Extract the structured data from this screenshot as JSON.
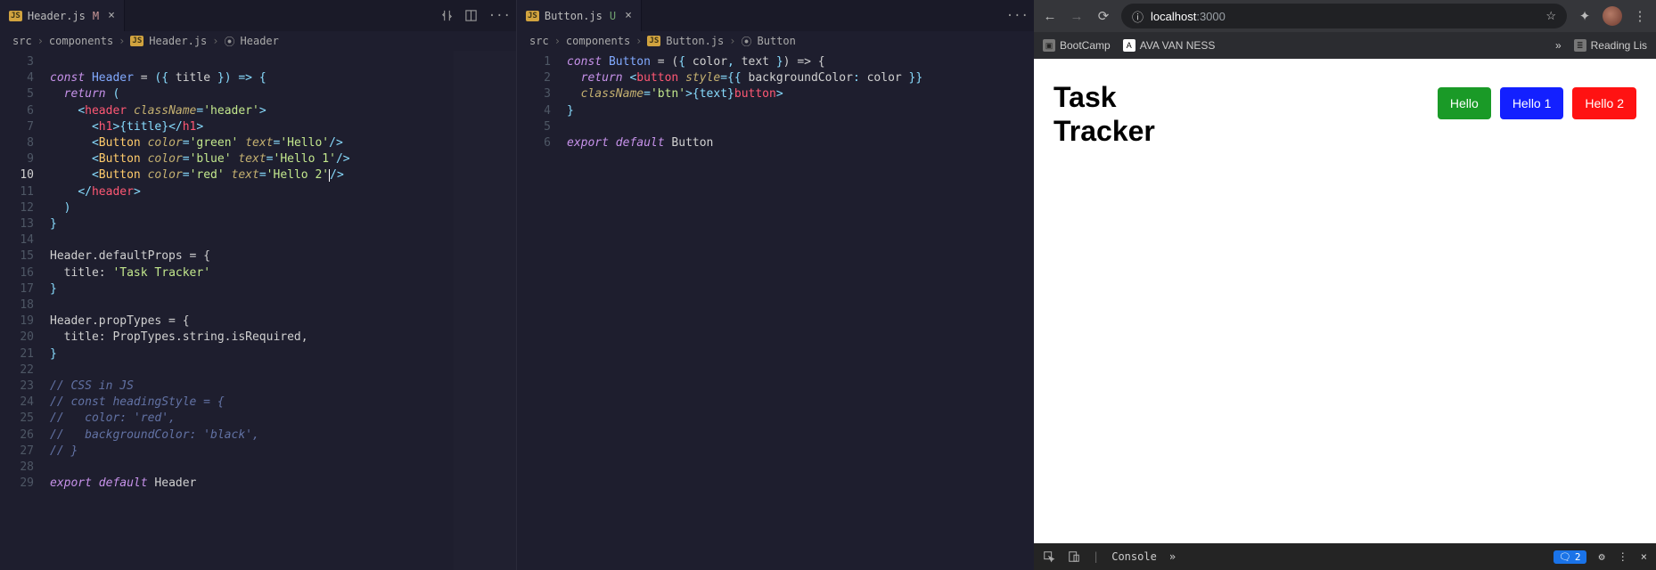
{
  "left": {
    "tab": {
      "file": "Header.js",
      "status": "M"
    },
    "breadcrumb": {
      "p1": "src",
      "p2": "components",
      "p3": "Header.js",
      "sym": "Header"
    },
    "lines_start": 3,
    "lines_end": 29,
    "tokens": {
      "const": "const",
      "header_name": "Header",
      "eq": " = ",
      "paren_open": "(",
      "brace_open": "{",
      "title_param": "title",
      "brace_close": "}",
      "paren_close": ")",
      "arrow": " => ",
      "obrace": "{",
      "return": "return",
      "jsx_open": "(",
      "tag_header": "header",
      "attr_class": "className",
      "val_header": "'header'",
      "h1": "h1",
      "title_expr": "{title}",
      "btn_tag": "Button",
      "attr_color": "color",
      "attr_text": "text",
      "c_green": "'green'",
      "t_hello": "'Hello'",
      "c_blue": "'blue'",
      "t_hello1": "'Hello 1'",
      "c_red": "'red'",
      "t_hello2": "'Hello 2'",
      "defprops": "Header.defaultProps = {",
      "title_k": "title:",
      "tasktracker": "'Task Tracker'",
      "proptypes_l": "Header.propTypes = {",
      "pt_line": "title: PropTypes.string.isRequired,",
      "c1": "// CSS in JS",
      "c2": "// const headingStyle = {",
      "c3": "//   color: 'red',",
      "c4": "//   backgroundColor: 'black',",
      "c5": "// }",
      "export": "export",
      "default": "default",
      "hdr": "Header"
    }
  },
  "right": {
    "tab": {
      "file": "Button.js",
      "status": "U"
    },
    "breadcrumb": {
      "p1": "src",
      "p2": "components",
      "p3": "Button.js",
      "sym": "Button"
    },
    "tokens": {
      "const": "const",
      "btn": "Button",
      "eq": " = (",
      "ob": "{ ",
      "color": "color",
      "sep": ", ",
      "text": "text",
      "cb": " }",
      "pc": ") => {",
      "return": "return",
      "ob_t": "<",
      "button": "button",
      "sp": " ",
      "style": "style",
      "eq2": "=",
      "dbl": "{{ ",
      "bgc": "backgroundColor",
      "col": ": ",
      "colorv": "color",
      "dblc": " }}",
      "clname": "className",
      "btnv": "'btn'",
      "gt": ">",
      "texp": "{text}",
      "clbt": "</",
      "button2": "button",
      "gt2": ">",
      "export": "export",
      "default": "default",
      "btn2": "Button"
    },
    "lines": [
      1,
      2,
      3,
      4,
      5,
      6
    ]
  },
  "browser": {
    "url": {
      "scheme": "ⓘ",
      "host": "localhost",
      "port": ":3000"
    },
    "bookmarks": {
      "b1": "BootCamp",
      "b2": "AVA VAN NESS",
      "b3": "Reading Lis"
    },
    "page": {
      "title_l1": "Task",
      "title_l2": "Tracker",
      "buttons": [
        {
          "label": "Hello",
          "color": "#1a9a27"
        },
        {
          "label": "Hello 1",
          "color": "#1320ff"
        },
        {
          "label": "Hello 2",
          "color": "#ff1212"
        }
      ]
    },
    "devtools": {
      "tab": "Console",
      "count": "2"
    }
  }
}
